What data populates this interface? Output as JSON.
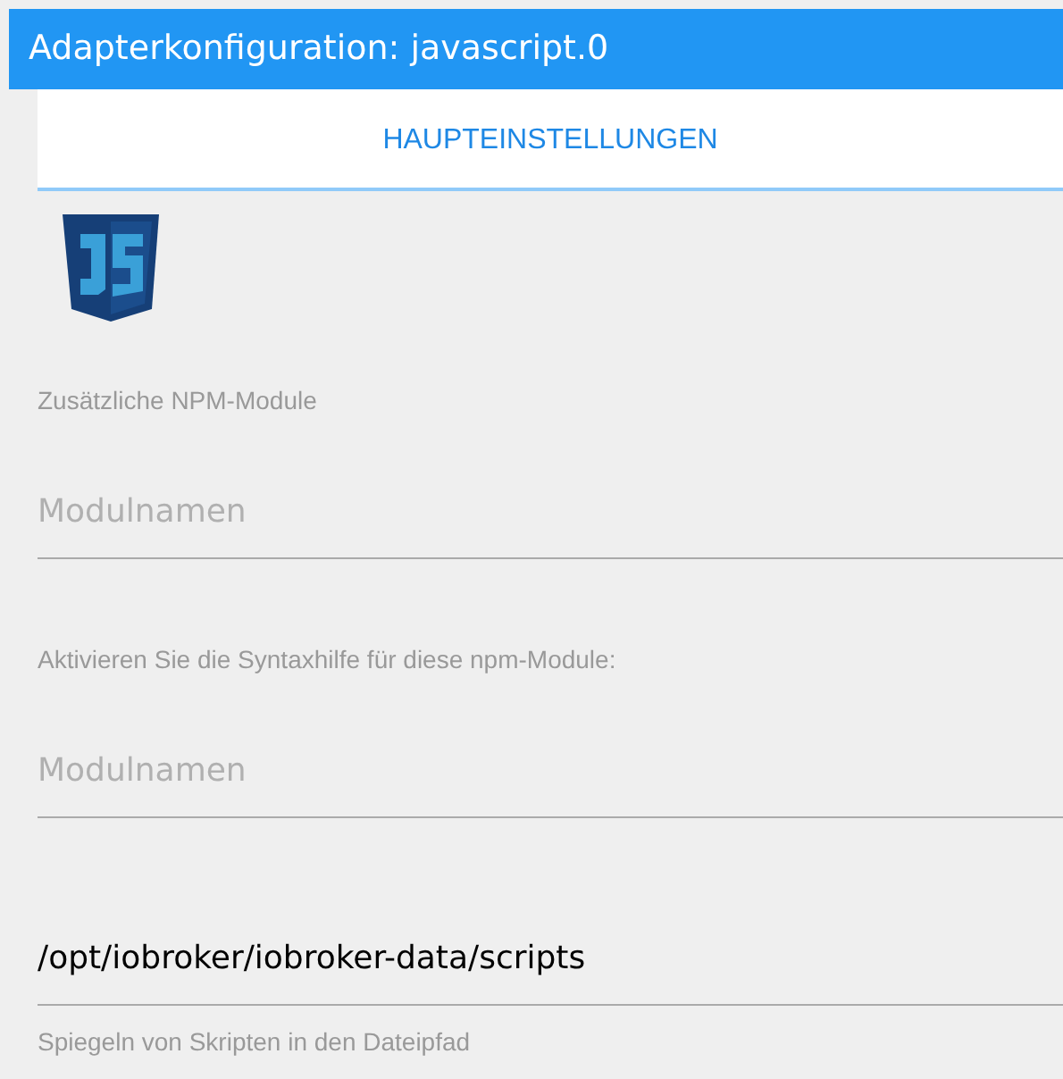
{
  "window": {
    "title": "Adapterkonfiguration: javascript.0"
  },
  "tabs": [
    {
      "label": "HAUPTEINSTELLUNGEN",
      "selected": true
    }
  ],
  "fields": [
    {
      "label": "Zusätzliche NPM-Module",
      "placeholder": "Modulnamen"
    },
    {
      "label": "Aktivieren Sie die Syntaxhilfe für diese npm-Module:",
      "placeholder": "Modulnamen"
    },
    {
      "value": "/opt/iobroker/iobroker-data/scripts",
      "helper": "Spiegeln von Skripten in den Dateipfad"
    }
  ]
}
